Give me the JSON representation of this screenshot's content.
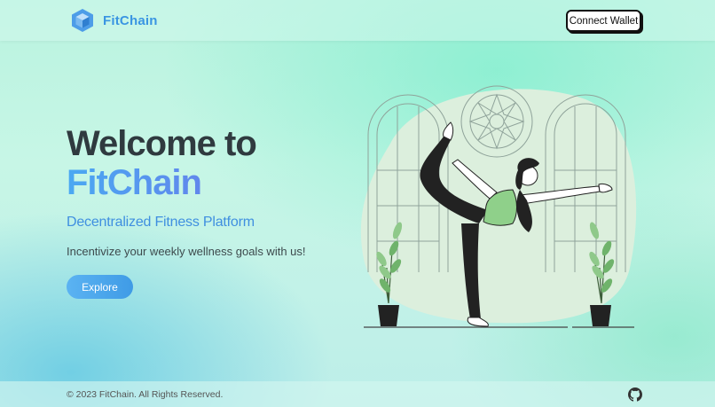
{
  "header": {
    "brand": "FitChain",
    "connect_label": "Connect Wallet",
    "logo_icon": "cube-icon"
  },
  "hero": {
    "title_line1": "Welcome to",
    "title_line2": "FitChain",
    "subtitle": "Decentralized Fitness Platform",
    "tagline": "Incentivize your weekly wellness goals with us!",
    "explore_label": "Explore",
    "illustration": "yoga-woman-illustration"
  },
  "footer": {
    "copyright": "© 2023 FitChain. All Rights Reserved.",
    "github_icon": "github-icon"
  },
  "colors": {
    "brand_blue": "#3a95e2",
    "accent_gradient_start": "#5bb3f2",
    "accent_gradient_end": "#3f9be6",
    "title_dark": "#2f3a3f",
    "mint_bg": "#c7f6e6"
  }
}
